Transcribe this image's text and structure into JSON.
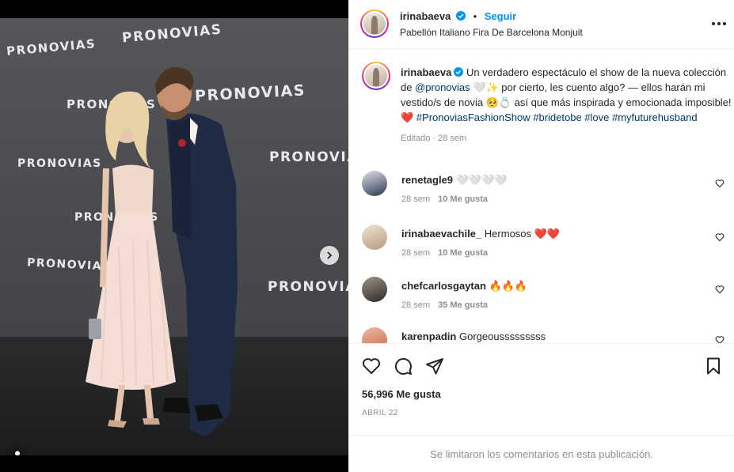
{
  "photo": {
    "brand_texts": [
      "PRONOVIAS",
      "PRONOVIAS",
      "PRONOVIAS",
      "PRONOVIAS",
      "PRONOVIAS",
      "PRONOVIAS",
      "PRONOVIAS",
      "PRONOVIAS",
      "PRONOVIAS"
    ],
    "carousel": {
      "count": 6,
      "active_index": 0
    },
    "icons": {
      "next": "chevron-right-icon",
      "tag": "user-tag-icon"
    }
  },
  "post": {
    "author": "irinabaeva",
    "follow_label": "Seguir",
    "separator": "•",
    "location": "Pabellón Italiano Fira De Barcelona Monjuit",
    "caption": {
      "username": "irinabaeva",
      "text_1": "Un verdadero espectáculo el show de la nueva colección de ",
      "mention": "@pronovias",
      "text_2": " 🤍✨ por cierto, les cuento algo? — ellos harán mi vestido/s de novia 🥺💍 así que más inspirada y emocionada imposible! ❤️ ",
      "hashtags": "#PronoviasFashionShow #bridetobe #love #myfuturehusband",
      "meta": "Editado · 28 sem"
    },
    "comments": [
      {
        "username": "renetagle9",
        "text": "🤍🤍🤍🤍",
        "time": "28 sem",
        "likes": "10 Me gusta"
      },
      {
        "username": "irinabaevachile_",
        "text": "Hermosos ❤️❤️",
        "time": "28 sem",
        "likes": "10 Me gusta"
      },
      {
        "username": "chefcarlosgaytan",
        "text": "🔥🔥🔥",
        "time": "28 sem",
        "likes": "35 Me gusta"
      },
      {
        "username": "karenpadin",
        "text": "Gorgeousssssssss",
        "time": "",
        "likes": ""
      }
    ],
    "likes_count": "56,996 Me gusta",
    "date": "ABRIL 22",
    "comments_limited": "Se limitaron los comentarios en esta publicación."
  },
  "colors": {
    "accent": "#0095f6",
    "link": "#00376b",
    "heart": "#ed4956"
  }
}
